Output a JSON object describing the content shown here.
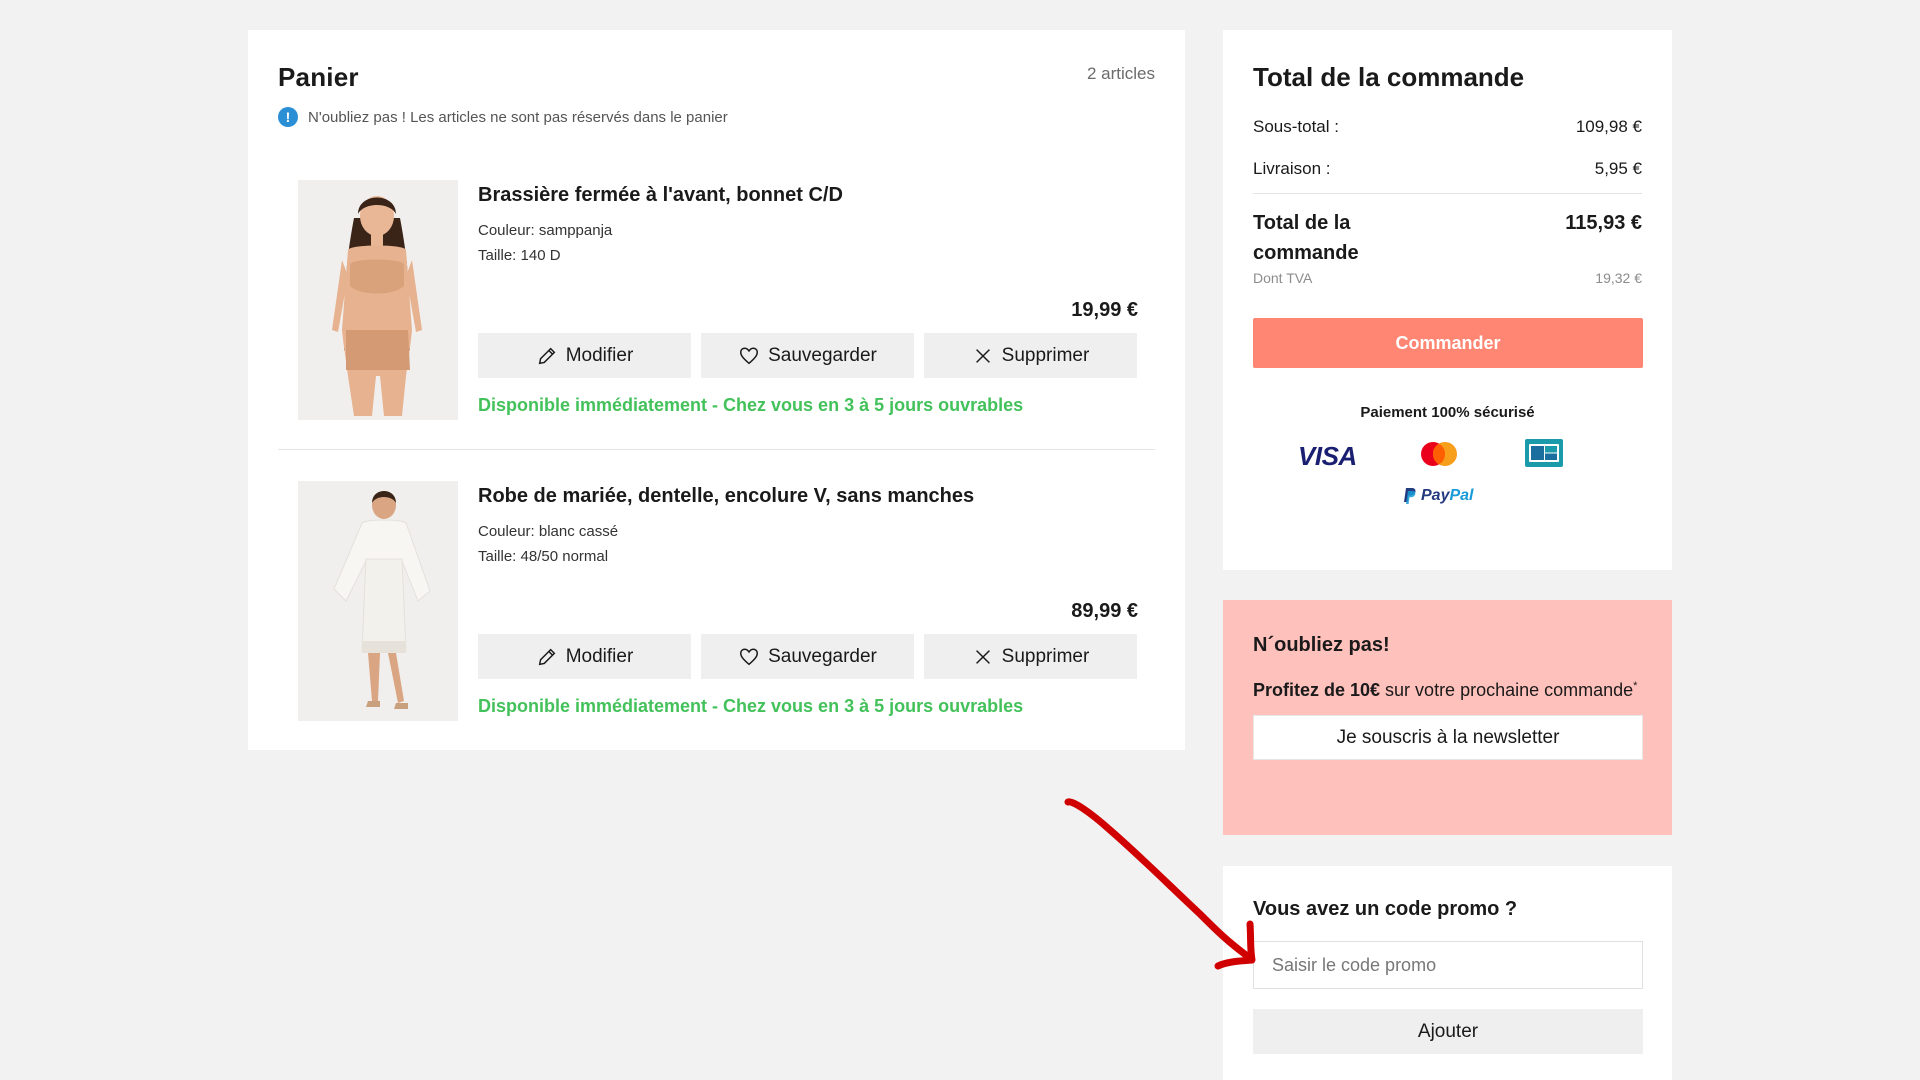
{
  "cart": {
    "title": "Panier",
    "count": "2 articles",
    "notice": "N'oubliez pas ! Les articles ne sont pas réservés dans le panier",
    "items": [
      {
        "name": "Brassière fermée à l'avant, bonnet C/D",
        "color": "Couleur: samppanja",
        "size": "Taille: 140 D",
        "price": "19,99 €",
        "edit": "Modifier",
        "save": "Sauvegarder",
        "remove": "Supprimer",
        "availability": "Disponible immédiatement - Chez vous en 3 à 5 jours ouvrables"
      },
      {
        "name": "Robe de mariée, dentelle, encolure V, sans manches",
        "color": "Couleur: blanc cassé",
        "size": "Taille: 48/50 normal",
        "price": "89,99 €",
        "edit": "Modifier",
        "save": "Sauvegarder",
        "remove": "Supprimer",
        "availability": "Disponible immédiatement - Chez vous en 3 à 5 jours ouvrables"
      }
    ]
  },
  "summary": {
    "title": "Total de la commande",
    "subtotal_label": "Sous-total :",
    "subtotal_value": "109,98 €",
    "shipping_label": "Livraison :",
    "shipping_value": "5,95 €",
    "total_label": "Total de la commande",
    "total_value": "115,93 €",
    "vat_label": "Dont TVA",
    "vat_value": "19,32 €",
    "order_button": "Commander",
    "secure_label": "Paiement 100% sécurisé",
    "payment_logos": [
      "VISA",
      "Mastercard",
      "CB",
      "PayPal"
    ],
    "visa_text": "VISA",
    "paypal_1": "Pay",
    "paypal_2": "Pal"
  },
  "newsletter": {
    "title": "N´oubliez pas!",
    "bold_text": "Profitez de 10€",
    "text": " sur votre prochaine commande",
    "sup": "*",
    "button": "Je souscris à la newsletter"
  },
  "promo": {
    "title": "Vous avez un code promo ?",
    "placeholder": "Saisir le code promo",
    "button": "Ajouter"
  },
  "colors": {
    "accent": "#ff8673",
    "availability": "#43c15a",
    "newsletter_bg": "#ffc1bc",
    "info_icon": "#2b8fd6",
    "annotation_arrow": "#d10000"
  }
}
